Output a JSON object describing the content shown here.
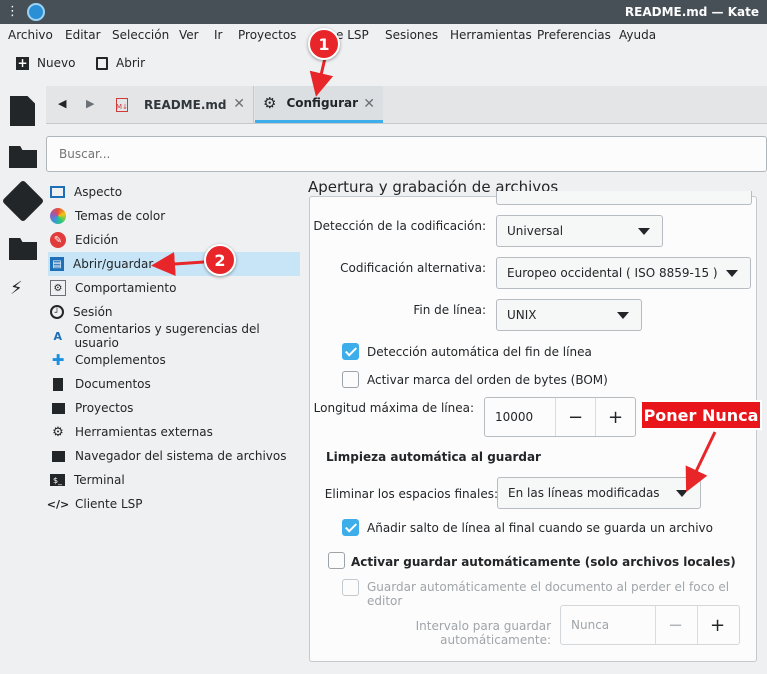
{
  "window": {
    "title": "README.md  — Kate"
  },
  "menu": [
    "Archivo",
    "Editar",
    "Selección",
    "Ver",
    "Ir",
    "Proyectos",
    "Clientes LSP",
    "Sesiones",
    "Herramientas",
    "Preferencias",
    "Ayuda"
  ],
  "menu_visible": {
    "m0": "Archivo",
    "m1": "Editar",
    "m2": "Selección",
    "m3": "Ver",
    "m4": "Ir",
    "m5": "Proyectos",
    "m6": "e LSP",
    "m7": "Sesiones",
    "m8": "Herramientas",
    "m9": "Preferencias",
    "m10": "Ayuda"
  },
  "toolbar": {
    "new_label": "Nuevo",
    "open_label": "Abrir"
  },
  "tabs": [
    {
      "label": "README.md"
    },
    {
      "label": "Configurar"
    }
  ],
  "search": {
    "placeholder": "Buscar..."
  },
  "sidebar": {
    "items": [
      {
        "label": "Aspecto",
        "icon": "monitor-icon"
      },
      {
        "label": "Temas de color",
        "icon": "palette-icon"
      },
      {
        "label": "Edición",
        "icon": "edit-icon"
      },
      {
        "label": "Abrir/guardar",
        "icon": "save-icon",
        "selected": true
      },
      {
        "label": "Comportamiento",
        "icon": "gear-icon"
      },
      {
        "label": "Sesión",
        "icon": "clock-icon"
      },
      {
        "label": "Comentarios y sugerencias del usuario",
        "icon": "feedback-icon"
      },
      {
        "label": "Complementos",
        "icon": "puzzle-icon"
      },
      {
        "label": "Documentos",
        "icon": "document-icon"
      },
      {
        "label": "Proyectos",
        "icon": "folder-icon"
      },
      {
        "label": "Herramientas externas",
        "icon": "tools-icon"
      },
      {
        "label": "Navegador del sistema de archivos",
        "icon": "folder-icon"
      },
      {
        "label": "Terminal",
        "icon": "terminal-icon"
      },
      {
        "label": "Cliente LSP",
        "icon": "code-icon"
      }
    ]
  },
  "content": {
    "title": "Apertura y grabación de archivos",
    "encoding_label": "Detección de la codificación:",
    "encoding_value": "Universal",
    "fallback_label": "Codificación alternativa:",
    "fallback_value": "Europeo occidental ( ISO 8859-15 )",
    "eol_label": "Fin de línea:",
    "eol_value": "UNIX",
    "auto_eol": "Detección automática del fin de línea",
    "bom": "Activar marca del orden de bytes (BOM)",
    "maxlen_label": "Longitud máxima de línea:",
    "maxlen_value": "10000",
    "cleanup_header": "Limpieza automática al guardar",
    "trailing_label": "Eliminar los espacios finales:",
    "trailing_value": "En las líneas modificadas",
    "newline_eof": "Añadir salto de línea al final cuando se guarda un archivo",
    "autosave": "Activar guardar automáticamente (solo archivos locales)",
    "autosave_focus": "Guardar automáticamente el documento al perder el foco el editor",
    "interval_label": "Intervalo para guardar automáticamente:",
    "interval_value": "Nunca"
  },
  "annotations": {
    "badge1": "1",
    "badge2": "2",
    "callout": "Poner Nunca"
  },
  "colors": {
    "accent": "#3daee9",
    "annotation": "#e8262a",
    "selection": "#c8e5f7"
  }
}
